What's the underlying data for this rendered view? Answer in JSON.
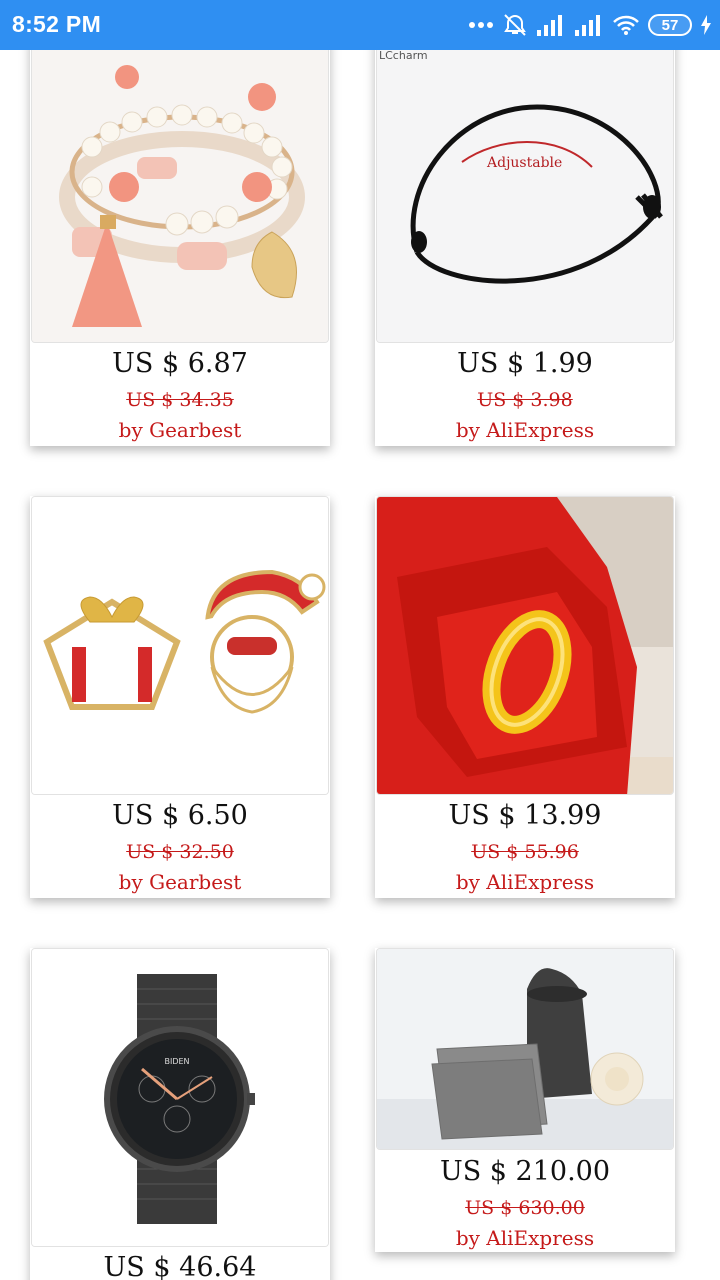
{
  "status_bar": {
    "time": "8:52 PM",
    "battery": "57",
    "icons": [
      "more-dots-icon",
      "alarm-off-icon",
      "signal-icon",
      "signal-icon",
      "wifi-icon",
      "battery-icon",
      "charging-icon"
    ]
  },
  "products": [
    {
      "price": "US $ 6.87",
      "old_price": "US $ 34.35",
      "seller": "by Gearbest",
      "image": "bracelet-image",
      "image_text": ""
    },
    {
      "price": "US $ 1.99",
      "old_price": "US $ 3.98",
      "seller": "by AliExpress",
      "image": "cord-bracelet-image",
      "image_text": "Adjustable",
      "image_brand": "LCcharm"
    },
    {
      "price": "US $ 6.50",
      "old_price": "US $ 32.50",
      "seller": "by Gearbest",
      "image": "christmas-earrings-image",
      "image_text": ""
    },
    {
      "price": "US $ 13.99",
      "old_price": "US $ 55.96",
      "seller": "by AliExpress",
      "image": "gold-ring-image",
      "image_text": ""
    },
    {
      "price": "US $ 46.64",
      "old_price": "",
      "seller": "",
      "image": "watch-image",
      "image_text": "BIDEN"
    },
    {
      "price": "US $ 210.00",
      "old_price": "US $ 630.00",
      "seller": "by AliExpress",
      "image": "pouches-image",
      "image_text": ""
    }
  ],
  "colors": {
    "status_bar": "#2f8ff2",
    "price_red": "#c51a1a"
  }
}
